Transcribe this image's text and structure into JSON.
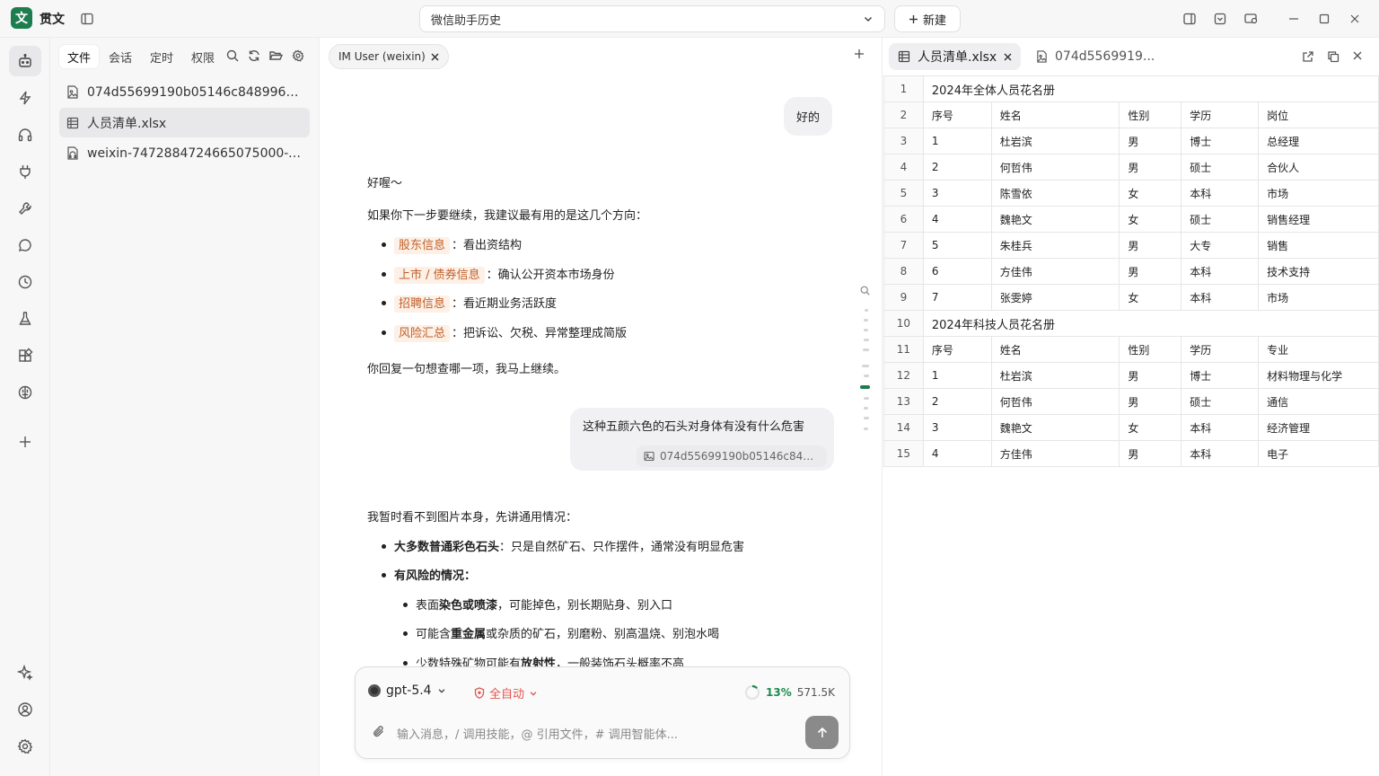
{
  "app": {
    "logo_char": "文",
    "name": "贯文"
  },
  "titlebar": {
    "session_title": "微信助手历史",
    "new_label": "新建"
  },
  "files": {
    "tabs": [
      "文件",
      "会话",
      "定时",
      "权限"
    ],
    "items": [
      {
        "name": "074d55699190b05146c8489968d...",
        "icon": "image-file-icon"
      },
      {
        "name": "人员清单.xlsx",
        "icon": "table-icon"
      },
      {
        "name": "weixin-7472884724665075000-vo...",
        "icon": "audio-file-icon"
      }
    ]
  },
  "chat": {
    "tab_label": "IM User (weixin)",
    "user1": "好的",
    "ai1": {
      "greet": "好喔～",
      "intro": "如果你下一步要继续，我建议最有用的是这几个方向：",
      "items": [
        {
          "tag": "股东信息",
          "sep": "：",
          "text": "看出资结构"
        },
        {
          "tag": "上市 / 债券信息",
          "sep": "：",
          "text": "确认公开资本市场身份"
        },
        {
          "tag": "招聘信息",
          "sep": "：",
          "text": "看近期业务活跃度"
        },
        {
          "tag": "风险汇总",
          "sep": "：",
          "text": "把诉讼、欠税、异常整理成简版"
        }
      ],
      "outro": "你回复一句想查哪一项，我马上继续。"
    },
    "user2": "这种五颜六色的石头对身体有没有什么危害",
    "user2_attachment": "074d55699190b05146c8489968...",
    "ai2": {
      "intro": "我暂时看不到图片本身，先讲通用情况：",
      "b1_bold": "大多数普通彩色石头",
      "b1_rest": "：只是自然矿石、只作摆件，通常没有明显危害",
      "b2_bold": "有风险的情况：",
      "s1": {
        "a": "表面",
        "b": "染色或喷漆",
        "c": "，可能掉色，别长期贴身、别入口"
      },
      "s2": {
        "a": "可能含",
        "b": "重金属",
        "c": "或杂质的矿石，别磨粉、别高温烧、别泡水喝"
      },
      "s3": {
        "a": "少数特殊矿物可能有",
        "b": "放射性",
        "c": "，一般装饰石头概率不高"
      }
    }
  },
  "composer": {
    "model": "gpt-5.4",
    "mode": "全自动",
    "ctx_pct": "13%",
    "ctx_progress": 0.13,
    "ctx_tokens": "571.5K",
    "placeholder": "输入消息，/ 调用技能，@ 引用文件，# 调用智能体..."
  },
  "sheet": {
    "tabs": [
      "人员清单.xlsx",
      "074d5569919..."
    ],
    "rows": [
      {
        "n": "1",
        "title": "2024年全体人员花名册"
      },
      {
        "n": "2",
        "cells": [
          "序号",
          "姓名",
          "性别",
          "学历",
          "岗位"
        ]
      },
      {
        "n": "3",
        "cells": [
          "1",
          "杜岩滨",
          "男",
          "博士",
          "总经理"
        ]
      },
      {
        "n": "4",
        "cells": [
          "2",
          "何哲伟",
          "男",
          "硕士",
          "合伙人"
        ]
      },
      {
        "n": "5",
        "cells": [
          "3",
          "陈雪依",
          "女",
          "本科",
          "市场"
        ]
      },
      {
        "n": "6",
        "cells": [
          "4",
          "魏艳文",
          "女",
          "硕士",
          "销售经理"
        ]
      },
      {
        "n": "7",
        "cells": [
          "5",
          "朱桂兵",
          "男",
          "大专",
          "销售"
        ]
      },
      {
        "n": "8",
        "cells": [
          "6",
          "方佳伟",
          "男",
          "本科",
          "技术支持"
        ]
      },
      {
        "n": "9",
        "cells": [
          "7",
          "张雯婷",
          "女",
          "本科",
          "市场"
        ]
      },
      {
        "n": "10",
        "title": "2024年科技人员花名册"
      },
      {
        "n": "11",
        "cells": [
          "序号",
          "姓名",
          "性别",
          "学历",
          "专业"
        ]
      },
      {
        "n": "12",
        "cells": [
          "1",
          "杜岩滨",
          "男",
          "博士",
          "材料物理与化学"
        ]
      },
      {
        "n": "13",
        "cells": [
          "2",
          "何哲伟",
          "男",
          "硕士",
          "通信"
        ]
      },
      {
        "n": "14",
        "cells": [
          "3",
          "魏艳文",
          "女",
          "本科",
          "经济管理"
        ]
      },
      {
        "n": "15",
        "cells": [
          "4",
          "方佳伟",
          "男",
          "本科",
          "电子"
        ]
      }
    ]
  }
}
